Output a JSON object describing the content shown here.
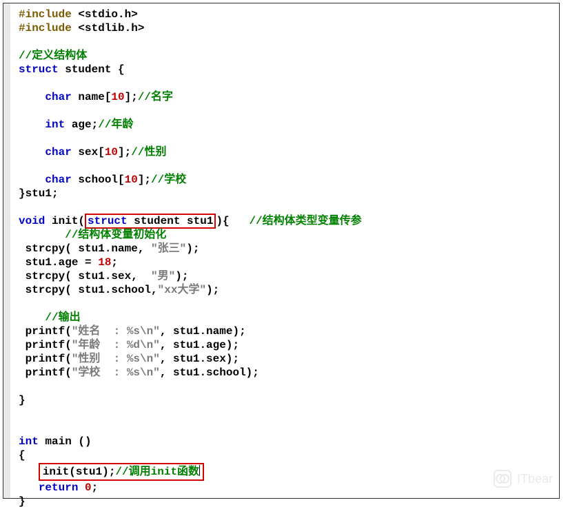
{
  "lines": {
    "l1a": "#include",
    "l1b": " <stdio.h>",
    "l2a": "#include",
    "l2b": " <stdlib.h>",
    "c_struct": "//定义结构体",
    "kw_struct": "struct",
    "id_student": " student {",
    "kw_char": "char",
    "name_decl": " name[",
    "n10": "10",
    "rb_sc": "];",
    "c_name": "//名字",
    "kw_int": "int",
    "age_decl": " age;",
    "c_age": "//年龄",
    "sex_decl": " sex[",
    "c_sex": "//性别",
    "school_decl": " school[",
    "c_school": "//学校",
    "close_stu": "}stu1;",
    "kw_void": "void",
    "init_txt": " init(",
    "param": "struct student stu1",
    "after_param": "){",
    "c_param": "//结构体类型变量传参",
    "c_initv": "//结构体变量初始化",
    "s1": " strcpy( stu1.name, ",
    "str1": "\"张三\"",
    "s1b": ");",
    "s2": " stu1.age = ",
    "n18": "18",
    "s2b": ";",
    "s3": " strcpy( stu1.sex,  ",
    "str3": "\"男\"",
    "s3b": ");",
    "s4": " strcpy( stu1.school,",
    "str4": "\"xx大学\"",
    "s4b": ");",
    "c_out": "//输出",
    "p1": " printf(",
    "ps1": "\"姓名  : %s\\n\"",
    "p1b": ", stu1.name);",
    "p2": " printf(",
    "ps2": "\"年龄  : %d\\n\"",
    "p2b": ", stu1.age);",
    "p3": " printf(",
    "ps3": "\"性别  : %s\\n\"",
    "p3b": ", stu1.sex);",
    "p4": " printf(",
    "ps4": "\"学校  : %s\\n\"",
    "p4b": ", stu1.school);",
    "brace_close": "}",
    "main_a": "int",
    "main_b": " main ()",
    "brace_open": "{",
    "call": "init(stu1);",
    "c_call": "//调用init函数",
    "ret_a": "return",
    "ret_b": " ",
    "ret_0": "0",
    "ret_c": ";"
  },
  "watermark": "ITbear"
}
